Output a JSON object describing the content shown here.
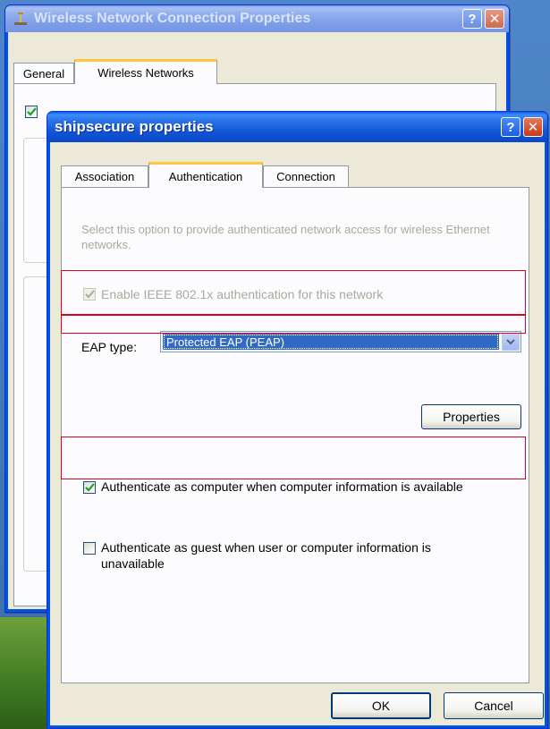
{
  "background_window": {
    "title": "Wireless Network Connection Properties",
    "tabs": [
      {
        "label": "General"
      },
      {
        "label": "Wireless Networks"
      }
    ]
  },
  "dialog": {
    "title": "shipsecure properties",
    "tabs": [
      {
        "label": "Association"
      },
      {
        "label": "Authentication"
      },
      {
        "label": "Connection"
      }
    ],
    "active_tab": "Authentication",
    "description": "Select this option to provide authenticated network access for wireless Ethernet networks.",
    "enable_8021x": {
      "label": "Enable IEEE 802.1x authentication for this network",
      "checked": true,
      "disabled": true
    },
    "eap_type": {
      "label": "EAP type:",
      "value": "Protected EAP (PEAP)"
    },
    "properties_button": "Properties",
    "auth_as_computer": {
      "label": "Authenticate as computer when computer information is available",
      "checked": true
    },
    "auth_as_guest": {
      "label": "Authenticate as guest when user or computer information is unavailable",
      "checked": false
    },
    "ok_button": "OK",
    "cancel_button": "Cancel",
    "title_help": "?",
    "title_close": "✕"
  },
  "colors": {
    "titlebar_active": "#0a49c6",
    "dialog_face": "#ece9d8",
    "highlight": "#e0001b",
    "selection": "#316ac5"
  }
}
